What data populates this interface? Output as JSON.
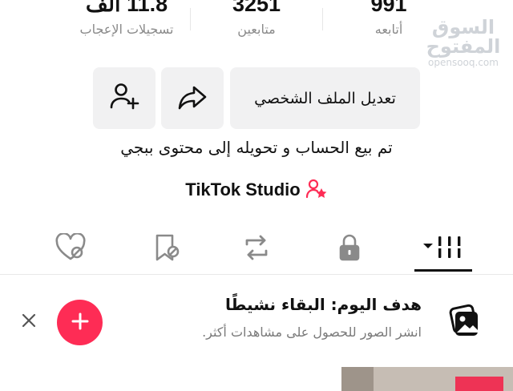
{
  "stats": {
    "likes": {
      "value": "11.8 ألف",
      "label": "تسجيلات الإعجاب"
    },
    "followers": {
      "value": "3251",
      "label": "متابعين"
    },
    "following": {
      "value": "991",
      "label": "أتابعه"
    }
  },
  "watermark": {
    "arabic": "السوق المفتوح",
    "latin": "opensooq.com"
  },
  "actions": {
    "edit_profile": "تعديل الملف الشخصي"
  },
  "bio": "تم بيع الحساب و تحويله إلى محتوى ببجي",
  "studio": {
    "label": "TikTok Studio"
  },
  "tabs": [
    {
      "icon": "grid-videos-icon",
      "active": true
    },
    {
      "icon": "lock-icon"
    },
    {
      "icon": "repost-icon"
    },
    {
      "icon": "bookmark-hidden-icon"
    },
    {
      "icon": "liked-hidden-icon"
    }
  ],
  "goal": {
    "title": "هدف اليوم: البقاء نشيطًا",
    "subtitle": "انشر الصور للحصول على مشاهدات أكثر."
  },
  "colors": {
    "accent": "#fe2c55",
    "text": "#111111",
    "muted": "#8a8a8a",
    "surface": "#f1f1f2"
  }
}
